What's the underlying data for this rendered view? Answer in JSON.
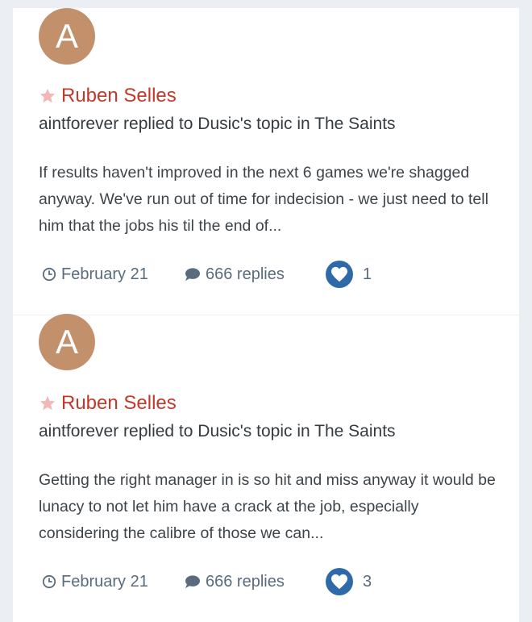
{
  "posts": [
    {
      "avatar_letter": "A",
      "title": "Ruben Selles",
      "author": "aintforever",
      "action": " replied to ",
      "topic_owner": "Dusic's",
      "topic_word": " topic in ",
      "forum": "The Saints",
      "snippet": "If results haven't improved in the next 6 games we're shagged anyway. We've run out of time for indecision - we just need to tell him that the jobs his til the end of...",
      "date": "February 21",
      "replies": "666 replies",
      "likes": "1"
    },
    {
      "avatar_letter": "A",
      "title": "Ruben Selles",
      "author": "aintforever",
      "action": " replied to ",
      "topic_owner": "Dusic's",
      "topic_word": " topic in ",
      "forum": "The Saints",
      "snippet": "Getting the right manager in is so hit and miss anyway it would be lunacy to not let him have a crack at the job, especially considering the calibre of those we can...",
      "date": "February 21",
      "replies": "666 replies",
      "likes": "3"
    }
  ],
  "colors": {
    "accent": "#c0392b",
    "avatar": "#c3906c",
    "like_badge": "#2f6aa8",
    "meta": "#5a6b7d"
  }
}
